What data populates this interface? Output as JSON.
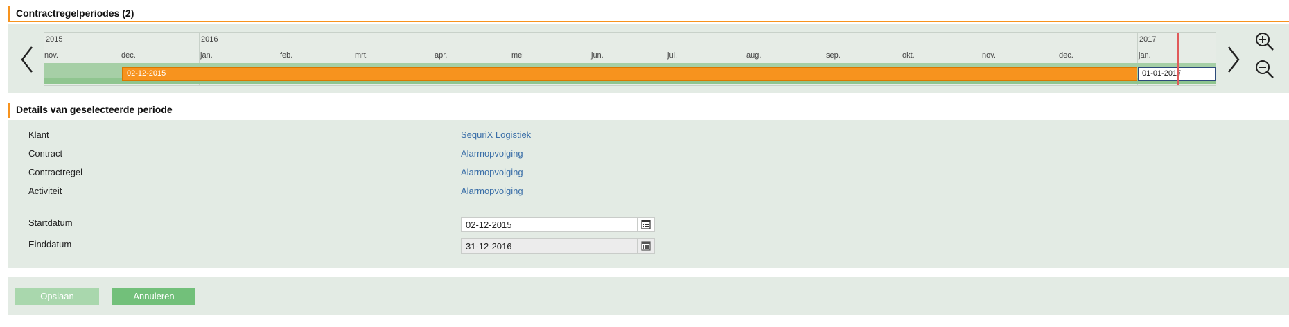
{
  "periods_section": {
    "title": "Contractregelperiodes (2)"
  },
  "timeline": {
    "years": [
      {
        "label": "2015"
      },
      {
        "label": "2016"
      },
      {
        "label": "2017"
      }
    ],
    "months": [
      "nov.",
      "dec.",
      "jan.",
      "feb.",
      "mrt.",
      "apr.",
      "mei",
      "jun.",
      "jul.",
      "aug.",
      "sep.",
      "okt.",
      "nov.",
      "dec.",
      "jan."
    ],
    "periods": [
      {
        "label": "02-12-2015",
        "state": "selected"
      },
      {
        "label": "01-01-2017",
        "state": "normal"
      }
    ],
    "prev_icon": "chevron-left-icon",
    "next_icon": "chevron-right-icon",
    "zoom_in_icon": "zoom-in-icon",
    "zoom_out_icon": "zoom-out-icon"
  },
  "details_section": {
    "title": "Details van geselecteerde periode"
  },
  "details": {
    "klant": {
      "label": "Klant",
      "value": "SequriX Logistiek"
    },
    "contract": {
      "label": "Contract",
      "value": "Alarmopvolging"
    },
    "contractregel": {
      "label": "Contractregel",
      "value": "Alarmopvolging"
    },
    "activiteit": {
      "label": "Activiteit",
      "value": "Alarmopvolging"
    },
    "startdatum": {
      "label": "Startdatum",
      "value": "02-12-2015"
    },
    "einddatum": {
      "label": "Einddatum",
      "value": "31-12-2016"
    }
  },
  "actions": {
    "save_label": "Opslaan",
    "cancel_label": "Annuleren"
  },
  "colors": {
    "accent": "#f7931e",
    "panel_bg": "#e3ebe4",
    "link": "#3b6fa8",
    "button_primary": "#72c07a",
    "button_disabled": "#a9d7ad",
    "today_marker": "#e05a5a"
  }
}
